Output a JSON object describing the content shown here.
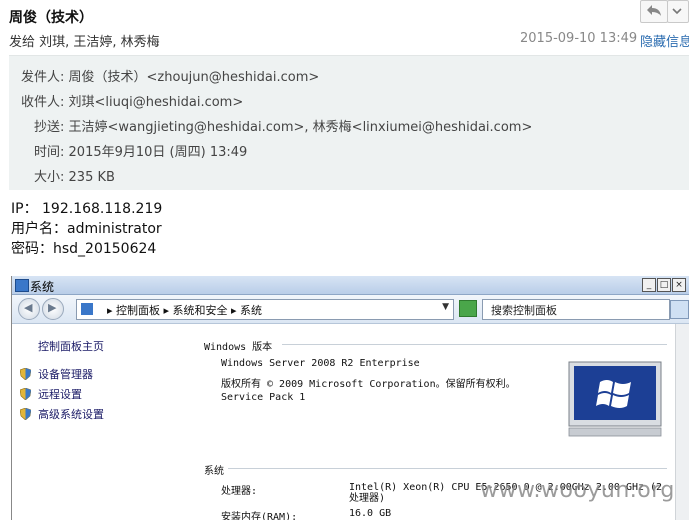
{
  "email": {
    "subject": "周俊（技术）",
    "to_line": "发给 刘琪, 王洁婷, 林秀梅",
    "date": "2015-09-10 13:49",
    "hide_details": "隐藏信息"
  },
  "details": {
    "from_label": "发件人:",
    "from_value": "周俊（技术）<zhoujun@heshidai.com>",
    "to_label": "收件人:",
    "to_value": "刘琪<liuqi@heshidai.com>",
    "cc_label": "抄送:",
    "cc_value": "王洁婷<wangjieting@heshidai.com>, 林秀梅<linxiumei@heshidai.com>",
    "time_label": "时间:",
    "time_value": "2015年9月10日 (周四) 13:49",
    "size_label": "大小:",
    "size_value": "235 KB"
  },
  "body": {
    "ip_line": "IP： 192.168.118.219",
    "user_line": "用户名：administrator",
    "pass_line": "密码：hsd_20150624"
  },
  "window": {
    "title": "系统",
    "min": "_",
    "max": "□",
    "close": "×",
    "breadcrumb": "▸ 控制面板 ▸ 系统和安全 ▸ 系统",
    "search_placeholder": "搜索控制面板",
    "left_pane": {
      "home": "控制面板主页",
      "items": [
        "设备管理器",
        "远程设置",
        "高级系统设置"
      ]
    },
    "edition_header": "Windows 版本",
    "edition": "Windows Server 2008 R2 Enterprise",
    "copyright": "版权所有 © 2009 Microsoft Corporation。保留所有权利。",
    "service_pack": "Service Pack 1",
    "system_header": "系统",
    "processor_label": "处理器:",
    "processor_value": "Intel(R) Xeon(R) CPU E5-2650 0 @ 2.00GHz   2.00 GHz  (2 处理器)",
    "ram_label": "安装内存(RAM):",
    "ram_value": "16.0 GB"
  },
  "watermark": "www.wooyun.org",
  "colors": {
    "details_bg": "#eef2f2",
    "link": "#2b6cb0",
    "windows_logo_bg": "#1c3f95"
  }
}
